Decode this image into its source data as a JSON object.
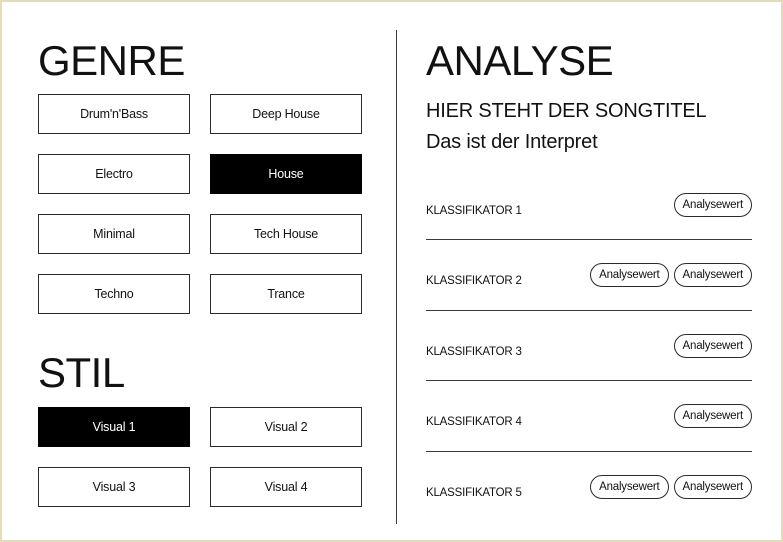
{
  "genre": {
    "title": "GENRE",
    "options": [
      {
        "label": "Drum'n'Bass",
        "selected": false
      },
      {
        "label": "Deep House",
        "selected": false
      },
      {
        "label": "Electro",
        "selected": false
      },
      {
        "label": "House",
        "selected": true
      },
      {
        "label": "Minimal",
        "selected": false
      },
      {
        "label": "Tech House",
        "selected": false
      },
      {
        "label": "Techno",
        "selected": false
      },
      {
        "label": "Trance",
        "selected": false
      }
    ]
  },
  "stil": {
    "title": "STIL",
    "options": [
      {
        "label": "Visual 1",
        "selected": true
      },
      {
        "label": "Visual 2",
        "selected": false
      },
      {
        "label": "Visual 3",
        "selected": false
      },
      {
        "label": "Visual 4",
        "selected": false
      }
    ]
  },
  "analyse": {
    "title": "ANALYSE",
    "song_title": "HIER STEHT DER SONGTITEL",
    "artist": "Das ist der Interpret",
    "classifiers": [
      {
        "label": "KLASSIFIKATOR 1",
        "values": [
          "Analysewert"
        ]
      },
      {
        "label": "KLASSIFIKATOR 2",
        "values": [
          "Analysewert",
          "Analysewert"
        ]
      },
      {
        "label": "KLASSIFIKATOR 3",
        "values": [
          "Analysewert"
        ]
      },
      {
        "label": "KLASSIFIKATOR 4",
        "values": [
          "Analysewert"
        ]
      },
      {
        "label": "KLASSIFIKATOR 5",
        "values": [
          "Analysewert",
          "Analysewert"
        ]
      }
    ]
  },
  "colors": {
    "background": "#ffffff",
    "frame_border": "#e2ddb6",
    "selected_fill": "#000000",
    "text": "#111111"
  }
}
